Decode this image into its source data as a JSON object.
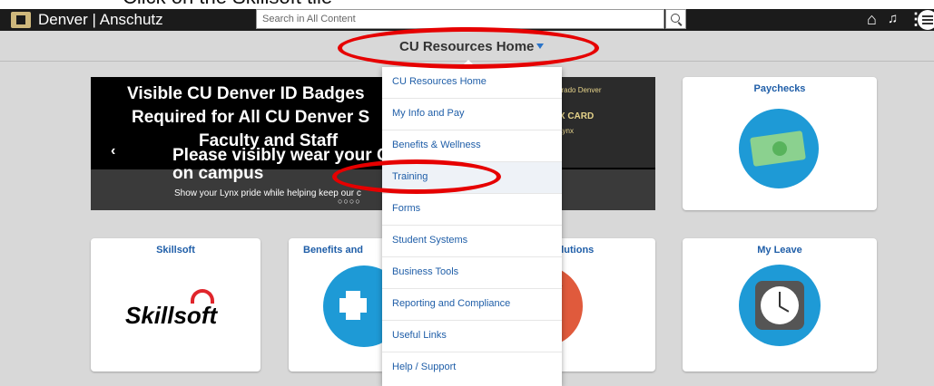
{
  "caption": "Click on the Skillsoft tile",
  "header": {
    "brand": "Denver | Anschutz",
    "search_placeholder": "Search in All Content"
  },
  "subbar": {
    "title": "CU Resources Home"
  },
  "banner": {
    "line1": "Visible CU Denver ID Badges",
    "line2": "Required for All CU Denver S",
    "line3": "Faculty and Staff",
    "line4": "Please visibly wear your CU",
    "line5": "on campus",
    "small": "Show your Lynx pride while helping keep our c",
    "card_top": "Colorado Denver",
    "card_mid": "YNX CARD",
    "card_sub": "the Lynx"
  },
  "tiles": {
    "paychecks": "Paychecks",
    "skillsoft": "Skillsoft",
    "skillsoft_logo": "Skillsoft",
    "benefits": "Benefits and",
    "solutions": "s Solutions",
    "my_leave": "My Leave"
  },
  "dropdown": {
    "items": [
      "CU Resources Home",
      "My Info and Pay",
      "Benefits & Wellness",
      "Training",
      "Forms",
      "Student Systems",
      "Business Tools",
      "Reporting and Compliance",
      "Useful Links",
      "Help / Support"
    ]
  },
  "colors": {
    "accent": "#1f5ea8",
    "annotation": "#e60000",
    "paychecks_circle": "#1e9ad6"
  }
}
